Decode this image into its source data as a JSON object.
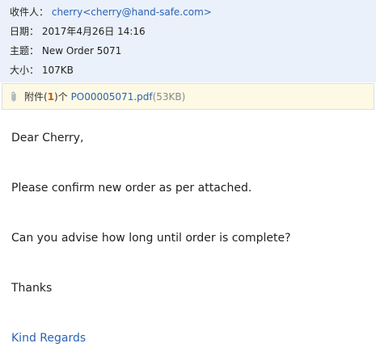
{
  "header": {
    "from_label": "收件人：",
    "from_value": "cherry<cherry@hand-safe.com>",
    "date_label": "日期：",
    "date_value": "2017年4月26日 14:16",
    "subject_label": "主题：",
    "subject_value": "New Order 5071",
    "size_label": "大小：",
    "size_value": "107KB"
  },
  "attachments": {
    "label_prefix": "附件(",
    "count": "1",
    "label_suffix": ")个",
    "file_name": "PO00005071.pdf",
    "file_size": "(53KB)"
  },
  "body": {
    "greeting": "Dear Cherry,",
    "line1": "Please confirm new order as per attached.",
    "line2": "Can you advise how long until order is complete?",
    "thanks": "Thanks",
    "signoff": "Kind Regards"
  },
  "colors": {
    "header_bg": "#eaf1fa",
    "attach_bg": "#fdf9e5",
    "link": "#2b62b3",
    "count": "#c25b00"
  }
}
